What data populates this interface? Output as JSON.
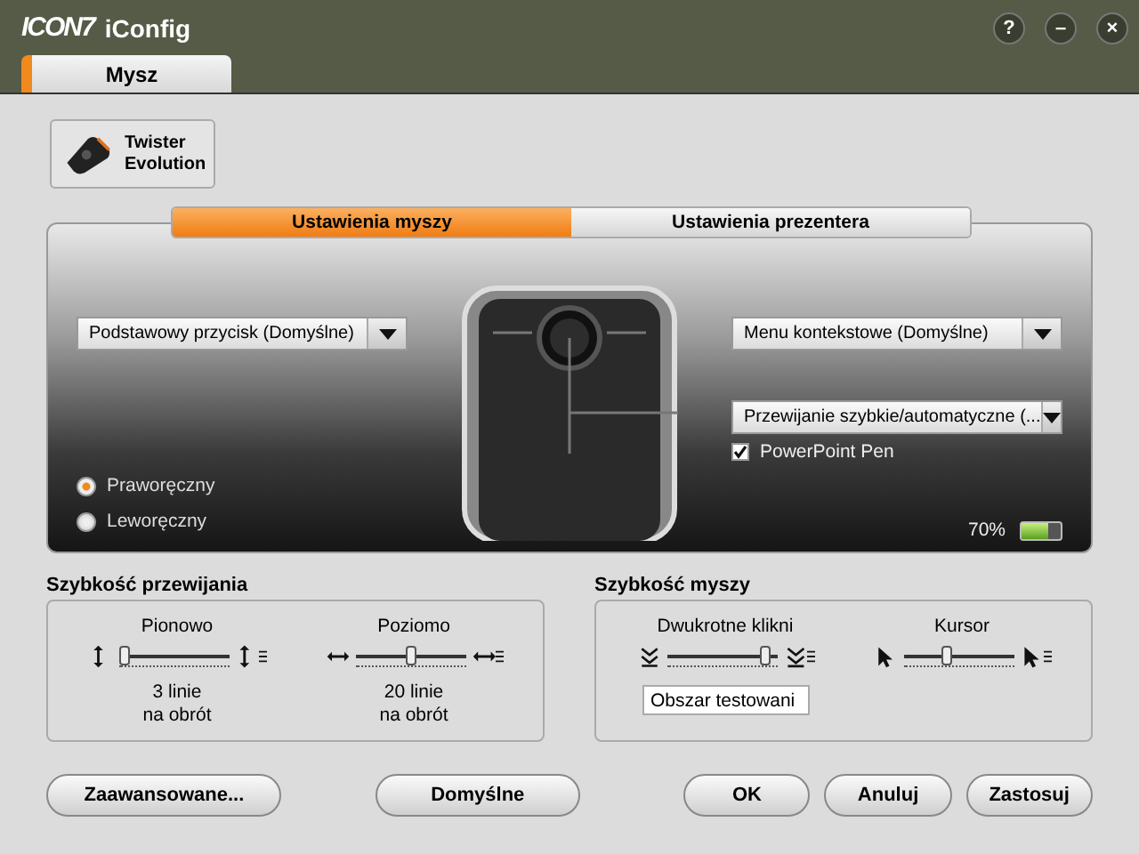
{
  "window": {
    "logo": "ICON7",
    "title": "iConfig",
    "controls": [
      "?",
      "–",
      "×"
    ]
  },
  "tabs": [
    {
      "label": "Mysz",
      "selected": true
    }
  ],
  "device": {
    "label": "Twister Evolution"
  },
  "mode_tabs": [
    {
      "label": "Ustawienia myszy",
      "selected": true
    },
    {
      "label": "Ustawienia prezentera",
      "selected": false
    }
  ],
  "left_button": {
    "value": "Podstawowy przycisk (Domyślne)"
  },
  "right_button": {
    "value": "Menu kontekstowe (Domyślne)"
  },
  "wheel": {
    "value": "Przewijanie  szybkie/automatyczne (..."
  },
  "powerpoint_pen": {
    "label": "PowerPoint Pen",
    "checked": true
  },
  "handedness": [
    {
      "label": "Praworęczny",
      "selected": true
    },
    {
      "label": "Leworęczny",
      "selected": false
    }
  ],
  "battery": {
    "reading": "70%",
    "level": 0.7
  },
  "scroll_speed": {
    "title": "Szybkość przewijania",
    "sliders": [
      {
        "label": "Pionowo",
        "level": 0.05,
        "reading": [
          "3 linie",
          "na obrót"
        ],
        "kind": "vertical"
      },
      {
        "label": "Poziomo",
        "level": 0.5,
        "reading": [
          "20 linie",
          "na obrót"
        ],
        "kind": "horizontal"
      }
    ]
  },
  "mouse_speed": {
    "title": "Szybkość myszy",
    "sliders": [
      {
        "label": "Dwukrotne klikni",
        "level": 0.9,
        "kind": "double-click"
      },
      {
        "label": "Kursor",
        "level": 0.4,
        "kind": "cursor"
      }
    ],
    "test_area": "Obszar testowani"
  },
  "buttons": [
    "Zaawansowane...",
    "Domyślne",
    "OK",
    "Anuluj",
    "Zastosuj"
  ]
}
